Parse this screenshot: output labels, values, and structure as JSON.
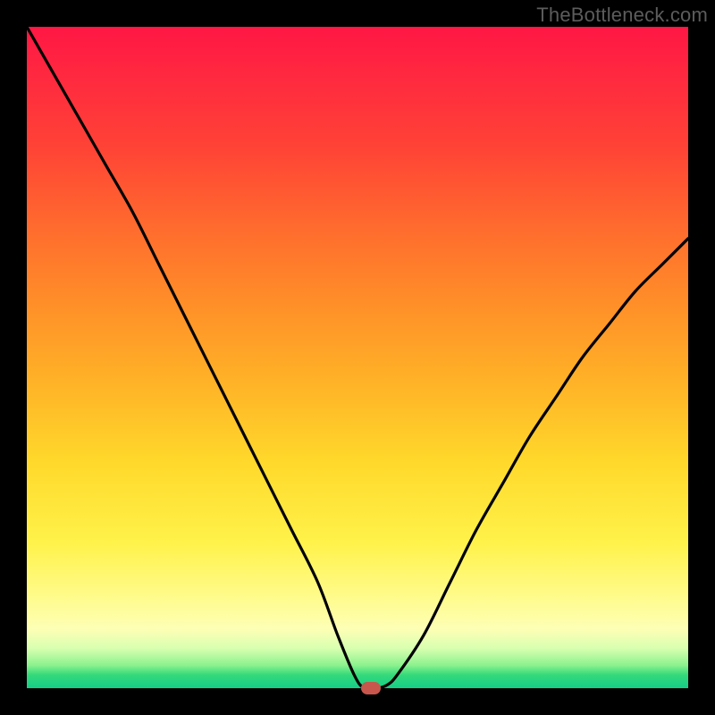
{
  "watermark": "TheBottleneck.com",
  "colors": {
    "curve": "#000000",
    "marker": "#c8564c",
    "frame": "#000000"
  },
  "chart_data": {
    "type": "line",
    "title": "",
    "xlabel": "",
    "ylabel": "",
    "xlim": [
      0,
      100
    ],
    "ylim": [
      0,
      100
    ],
    "grid": false,
    "legend": false,
    "series": [
      {
        "name": "bottleneck-curve",
        "x": [
          0,
          4,
          8,
          12,
          16,
          20,
          24,
          28,
          32,
          36,
          40,
          44,
          47,
          49.5,
          51,
          53,
          54.5,
          56,
          60,
          64,
          68,
          72,
          76,
          80,
          84,
          88,
          92,
          96,
          100
        ],
        "y": [
          100,
          93,
          86,
          79,
          72,
          64,
          56,
          48,
          40,
          32,
          24,
          16,
          8,
          2,
          0,
          0,
          0.5,
          2,
          8,
          16,
          24,
          31,
          38,
          44,
          50,
          55,
          60,
          64,
          68
        ]
      }
    ],
    "min_marker": {
      "x": 52,
      "y": 0
    },
    "background_gradient": {
      "orientation": "vertical",
      "stops": [
        {
          "pos": 0.0,
          "color": "#ff1744"
        },
        {
          "pos": 0.3,
          "color": "#ff6a2e"
        },
        {
          "pos": 0.66,
          "color": "#ffd92b"
        },
        {
          "pos": 0.86,
          "color": "#fffb8a"
        },
        {
          "pos": 0.96,
          "color": "#8ef28e"
        },
        {
          "pos": 1.0,
          "color": "#14cf86"
        }
      ]
    }
  }
}
